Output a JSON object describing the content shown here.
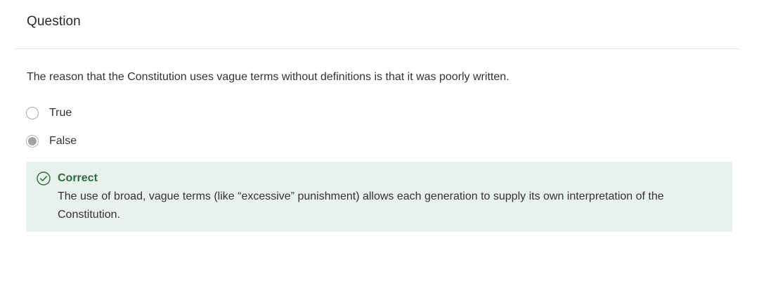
{
  "header": {
    "title": "Question"
  },
  "question": {
    "prompt": "The reason that the Constitution uses vague terms without definitions is that it was poorly written.",
    "options": [
      {
        "label": "True",
        "selected": false
      },
      {
        "label": "False",
        "selected": true
      }
    ]
  },
  "feedback": {
    "icon": "check-circle-icon",
    "status": "Correct",
    "explanation": "The use of broad, vague terms (like “excessive” punishment) allows each generation to supply its own interpretation of the Constitution.",
    "colors": {
      "background": "#e8f1ec",
      "accent": "#2e6b3f"
    }
  }
}
